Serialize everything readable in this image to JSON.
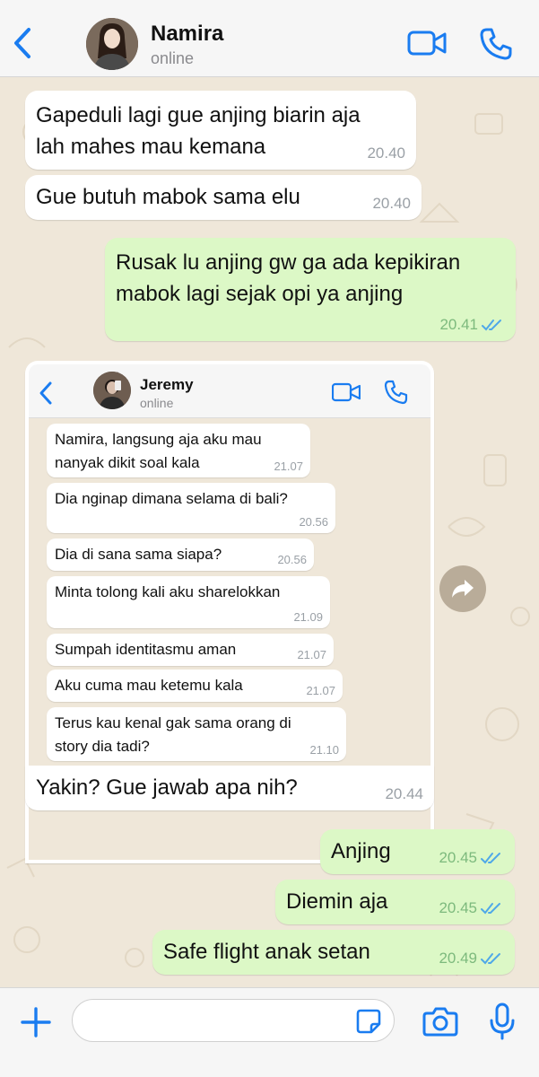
{
  "header": {
    "contact_name": "Namira",
    "status": "online"
  },
  "colors": {
    "accent": "#1a7cf0",
    "outgoing_bubble": "#dcf8c6",
    "incoming_bubble": "#ffffff",
    "wallpaper": "#efe7d9"
  },
  "messages": [
    {
      "text_line1": "Gapeduli lagi gue anjing biarin aja",
      "text_line2": "lah mahes mau kemana",
      "time": "20.40",
      "direction": "in"
    },
    {
      "text": "Gue butuh mabok sama elu",
      "time": "20.40",
      "direction": "in"
    },
    {
      "text_line1": "Rusak lu anjing gw ga ada kepikiran",
      "text_line2": "mabok lagi sejak opi ya anjing",
      "time": "20.41",
      "direction": "out",
      "read": true
    },
    {
      "text": "Yakin? Gue jawab apa nih?",
      "time": "20.44",
      "direction": "in"
    },
    {
      "text": "Anjing",
      "time": "20.45",
      "direction": "out",
      "read": true
    },
    {
      "text": "Diemin aja",
      "time": "20.45",
      "direction": "out",
      "read": true
    },
    {
      "text": "Safe flight anak setan",
      "time": "20.49",
      "direction": "out",
      "read": true
    }
  ],
  "screenshot": {
    "contact_name": "Jeremy",
    "status": "online",
    "messages": [
      {
        "line1": "Namira, langsung aja aku mau",
        "line2": "nanyak dikit soal kala",
        "time": "21.07"
      },
      {
        "text": "Dia nginap dimana selama di bali?",
        "time": "20.56"
      },
      {
        "text": "Dia di sana sama siapa?",
        "time": "20.56"
      },
      {
        "text": "Minta tolong kali aku sharelokkan",
        "time": "21.09"
      },
      {
        "text": "Sumpah identitasmu aman",
        "time": "21.07"
      },
      {
        "text": "Aku cuma mau ketemu kala",
        "time": "21.07"
      },
      {
        "line1": "Terus kau kenal gak sama orang di",
        "line2": "story dia tadi?",
        "time": "21.10"
      }
    ]
  },
  "input": {
    "placeholder": ""
  },
  "icons": [
    "back-chevron-icon",
    "video-camera-icon",
    "phone-icon",
    "forward-arrow-icon",
    "plus-icon",
    "sticker-icon",
    "camera-icon",
    "microphone-icon",
    "double-check-icon"
  ]
}
